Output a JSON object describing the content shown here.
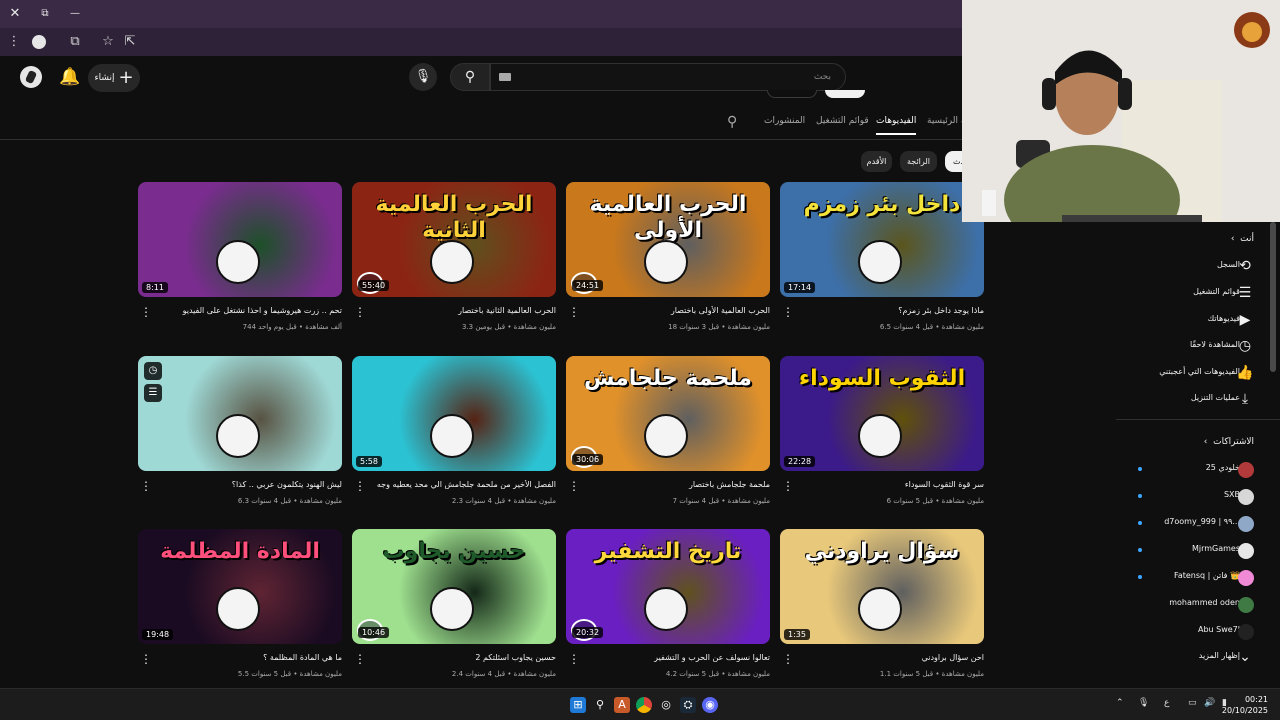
{
  "browser": {
    "close_glyph": "✕",
    "restore_glyph": "⧉",
    "minimize_glyph": "—"
  },
  "header": {
    "create_label": "إنشاء",
    "search_placeholder": "بحث",
    "icons": [
      "avatar",
      "bell-icon",
      "mic-icon",
      "search-icon"
    ]
  },
  "channel_tabs": [
    {
      "label": "الصفحة الرئيسية",
      "active": false
    },
    {
      "label": "الفيديوهات",
      "active": true
    },
    {
      "label": "قوائم التشغيل",
      "active": false
    },
    {
      "label": "المنشورات",
      "active": false
    }
  ],
  "chips": [
    {
      "label": "الأحدث",
      "active": true
    },
    {
      "label": "الرائجة",
      "active": false
    },
    {
      "label": "الأقدم",
      "active": false
    }
  ],
  "videos": [
    {
      "title": "ماذا يوجد داخل بئر زمزم؟",
      "meta": "6.5 مليون مشاهدة • قبل 4 سنوات",
      "duration": "17:14",
      "thumb_text": "داخل بئر زمزم",
      "bg": "#3d6fa8",
      "accent": "#f4e33b"
    },
    {
      "title": "الحرب العالمية الأولى باختصار",
      "meta": "18 مليون مشاهدة • قبل 3 سنوات",
      "duration": "24:51",
      "thumb_text": "الحرب العالمية الأولى",
      "bg": "#c9781c",
      "accent": "#ffffff"
    },
    {
      "title": "الحرب العالمية الثانية باختصار",
      "meta": "3.3 مليون مشاهدة • قبل يومين",
      "duration": "55:40",
      "thumb_text": "الحرب العالمية الثانية",
      "bg": "#8c2414",
      "accent": "#ffd23a"
    },
    {
      "title": "تحم .. زرت هيروشيما و احذا نشتغل على الفيديو",
      "meta": "744 ألف مشاهدة • قبل يوم واحد",
      "duration": "8:11",
      "thumb_text": "",
      "bg": "#7a2c8f",
      "accent": "#39d35b"
    },
    {
      "title": "سر قوة الثقوب السوداء",
      "meta": "6 مليون مشاهدة • قبل 5 سنوات",
      "duration": "22:28",
      "thumb_text": "الثقوب السوداء",
      "bg": "#3b1a8a",
      "accent": "#ffd400"
    },
    {
      "title": "ملحمة جلجامش باختصار",
      "meta": "7 مليون مشاهدة • قبل 4 سنوات",
      "duration": "30:06",
      "thumb_text": "ملحمة جلجامش",
      "bg": "#e1912a",
      "accent": "#ffffff"
    },
    {
      "title": "الفصل الأخير من ملحمة جلجامش الي محد يعطيه وجه",
      "meta": "2.3 مليون مشاهدة • قبل 4 سنوات",
      "duration": "5:58",
      "thumb_text": "",
      "bg": "#2bc3d4",
      "accent": "#e24a1c"
    },
    {
      "title": "ليش الهنود يتكلمون عربي .. كذا؟",
      "meta": "6.3 مليون مشاهدة • قبل 4 سنوات",
      "duration": "",
      "thumb_text": "",
      "bg": "#9fd9d6",
      "accent": "#e9d9a8"
    },
    {
      "title": "احن سؤال براودني",
      "meta": "1.1 مليون مشاهدة • قبل 5 سنوات",
      "duration": "1:35",
      "thumb_text": "سؤال يراودني",
      "bg": "#e8c87a",
      "accent": "#ffffff"
    },
    {
      "title": "تعالوا نسولف عن الحرب و التشفير",
      "meta": "4.2 مليون مشاهدة • قبل 5 سنوات",
      "duration": "20:32",
      "thumb_text": "تاريخ التشفير",
      "bg": "#6a1fc2",
      "accent": "#ffd93b"
    },
    {
      "title": "حسين يجاوب اسئلتكم 2",
      "meta": "2.4 مليون مشاهدة • قبل 4 سنوات",
      "duration": "10:46",
      "thumb_text": "حسين يجاوب",
      "bg": "#9fe08f",
      "accent": "#1e5a2a"
    },
    {
      "title": "ما هي المادة المظلمة ؟",
      "meta": "5.5 مليون مشاهدة • قبل 5 سنوات",
      "duration": "19:48",
      "thumb_text": "المادة المظلمة",
      "bg": "#1a0b22",
      "accent": "#ff4f7c"
    }
  ],
  "sidebar": {
    "you_label": "أنت",
    "you_items": [
      {
        "label": "السجل",
        "icon": "⟲"
      },
      {
        "label": "قوائم التشغيل",
        "icon": "☰"
      },
      {
        "label": "فيديوهاتك",
        "icon": "▶"
      },
      {
        "label": "المشاهدة لاحقًا",
        "icon": "◷"
      },
      {
        "label": "الفيديوهات التي أعجبتني",
        "icon": "👍"
      },
      {
        "label": "عمليات التنزيل",
        "icon": "⤓"
      }
    ],
    "subs_label": "الاشتراكات",
    "subscriptions": [
      {
        "label": "خلودي 25",
        "color": "#b33a3a",
        "dot": true
      },
      {
        "label": "SXB",
        "color": "#d7d7d7",
        "dot": true
      },
      {
        "label": "d7oomy_999 | ٩٩...",
        "color": "#8fa8c8",
        "dot": true
      },
      {
        "label": "MjrmGames",
        "color": "#e6e6e6",
        "dot": true
      },
      {
        "label": "Fatensq | فاتن 👑",
        "color": "#f08ad6",
        "dot": true
      },
      {
        "label": "mohammed oden",
        "color": "#3f7a45",
        "dot": false
      },
      {
        "label": "Abu Swe7l",
        "color": "#222222",
        "dot": false
      }
    ],
    "show_more_label": "إظهار المزيد"
  },
  "taskbar": {
    "time": "00:21",
    "date": "20/10/2025",
    "lang": "ع"
  }
}
